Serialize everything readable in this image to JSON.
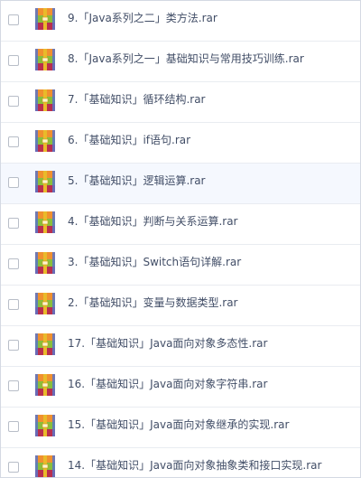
{
  "file_list": {
    "icon": "rar-archive-icon",
    "colors": {
      "text": "#424e67",
      "row_highlight": "#f5f8fe",
      "icon_top": "#f0902f",
      "icon_middle": "#89be3c",
      "icon_bottom": "#b92f4e",
      "icon_side": "#5a76c9",
      "icon_band": "#e9ba2a"
    },
    "files": [
      {
        "name": "9.「Java系列之二」类方法.rar"
      },
      {
        "name": "8.「Java系列之一」基础知识与常用技巧训练.rar"
      },
      {
        "name": "7.「基础知识」循环结构.rar"
      },
      {
        "name": "6.「基础知识」if语句.rar"
      },
      {
        "name": "5.「基础知识」逻辑运算.rar"
      },
      {
        "name": "4.「基础知识」判断与关系运算.rar"
      },
      {
        "name": "3.「基础知识」Switch语句详解.rar"
      },
      {
        "name": "2.「基础知识」变量与数据类型.rar"
      },
      {
        "name": "17.「基础知识」Java面向对象多态性.rar"
      },
      {
        "name": "16.「基础知识」Java面向对象字符串.rar"
      },
      {
        "name": "15.「基础知识」Java面向对象继承的实现.rar"
      },
      {
        "name": "14.「基础知识」Java面向对象抽象类和接口实现.rar"
      }
    ]
  }
}
